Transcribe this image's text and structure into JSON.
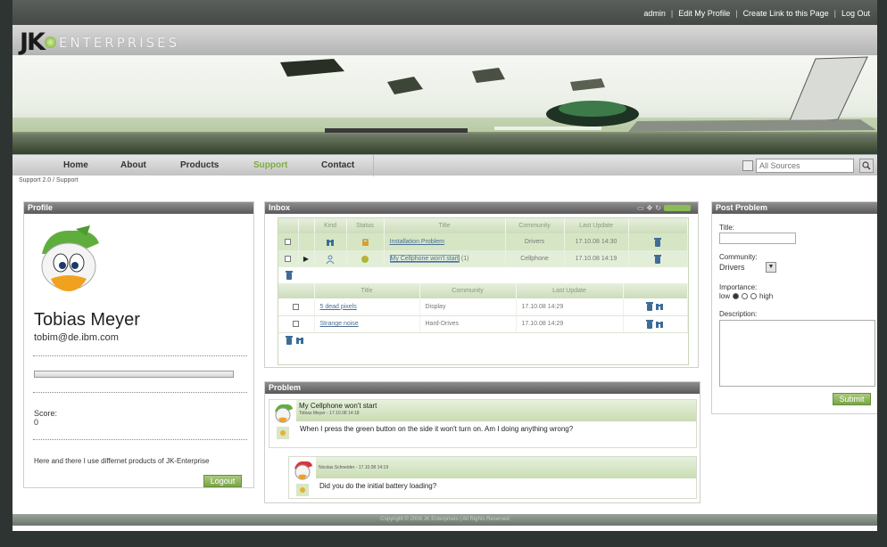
{
  "header": {
    "user_links": [
      "admin",
      "Edit My Profile",
      "Create Link to this Page",
      "Log Out"
    ],
    "logo_jk": "JK",
    "logo_text": "ENTERPRISES"
  },
  "nav": {
    "items": [
      "Home",
      "About",
      "Products",
      "Support",
      "Contact"
    ],
    "active": "Support",
    "search_placeholder": "All Sources"
  },
  "breadcrumb": "Support 2.0 / Support",
  "profile": {
    "title": "Profile",
    "name": "Tobias Meyer",
    "email": "tobim@de.ibm.com",
    "score_label": "Score:",
    "score_value": "0",
    "description": "Here and there I use differnet products of JK-Enterprise",
    "logout_label": "Logout"
  },
  "inbox": {
    "title": "Inbox",
    "columns": [
      "Kind",
      "Status",
      "Title",
      "Community",
      "Last Update"
    ],
    "rows": [
      {
        "title": "Installation Problem",
        "count": "",
        "community": "Drivers",
        "updated": "17.10.08 14:30"
      },
      {
        "title": "My Cellphone won't start",
        "count": "(1)",
        "community": "Cellphone",
        "updated": "17.10.08 14:19"
      }
    ],
    "sub_columns": [
      "Title",
      "Community",
      "Last Update"
    ],
    "sub_rows": [
      {
        "title": "5 dead pixels",
        "community": "Display",
        "updated": "17.10.08 14:29"
      },
      {
        "title": "Strange noise",
        "community": "Hard-Drives",
        "updated": "17.10.08 14:29"
      }
    ]
  },
  "problem": {
    "title": "Problem",
    "post": {
      "title": "My Cellphone won't start",
      "meta": "Tobias Meyer - 17.10.08 14:18",
      "body": "When I press the green button on the side it won't turn on. Am I doing anything wrong?"
    },
    "reply": {
      "meta": "Nicolas Schneider - 17.10.08 14:19",
      "body": "Did you do the initial battery loading?"
    }
  },
  "post_problem": {
    "title": "Post Problem",
    "title_label": "Title:",
    "community_label": "Community:",
    "community_value": "Drivers",
    "importance_label": "Importance:",
    "importance_low": "low",
    "importance_high": "high",
    "description_label": "Description:",
    "submit_label": "Submit"
  },
  "footer": "Copyright © 2008 JK Enterprises | All Rights Reserved",
  "colors": {
    "accent_green": "#7cae3c",
    "panel_header": "#6e6e6e",
    "table_green": "#d6e6c5"
  }
}
